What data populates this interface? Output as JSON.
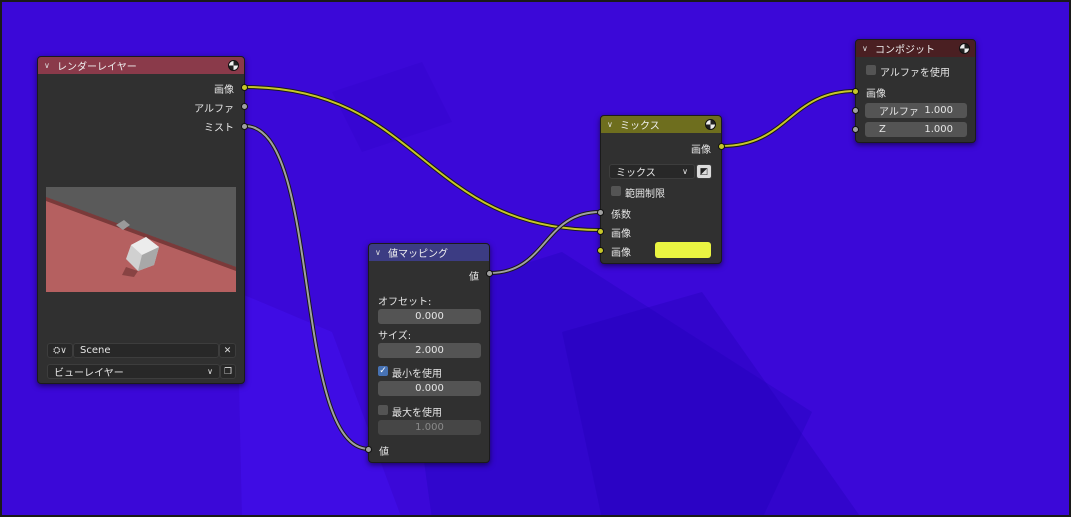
{
  "colors": {
    "canvas": "#3b08d8",
    "wire_yellow": "#c7c729",
    "wire_gray": "#a1a1a1",
    "render_layers_header": "#8a3a4a",
    "map_value_header": "#3c3c83",
    "mix_header": "#6e6e1e",
    "composite_header": "#4a1f22",
    "color_swatch": "#eaf542"
  },
  "render_layers": {
    "title": "レンダーレイヤー",
    "outputs": [
      "画像",
      "アルファ",
      "ミスト"
    ],
    "scene_value": "Scene",
    "view_layer_value": "ビューレイヤー"
  },
  "map_value": {
    "title": "値マッピング",
    "output": "値",
    "offset_label": "オフセット:",
    "offset_value": "0.000",
    "size_label": "サイズ:",
    "size_value": "2.000",
    "use_min_label": "最小を使用",
    "use_min": true,
    "min_value": "0.000",
    "use_max_label": "最大を使用",
    "use_max": false,
    "max_value": "1.000",
    "input": "値"
  },
  "mix": {
    "title": "ミックス",
    "output": "画像",
    "blend_mode": "ミックス",
    "clamp_label": "範囲制限",
    "clamp": false,
    "inputs": [
      "係数",
      "画像",
      "画像"
    ]
  },
  "composite": {
    "title": "コンポジット",
    "use_alpha_label": "アルファを使用",
    "use_alpha": false,
    "input_image": "画像",
    "alpha_label": "アルファ",
    "alpha_value": "1.000",
    "z_label": "Z",
    "z_value": "1.000"
  },
  "icons": [
    "chevron-down-icon",
    "node-ball-icon",
    "scene-icon",
    "close-icon",
    "browse-icon",
    "duplicate-icon"
  ]
}
